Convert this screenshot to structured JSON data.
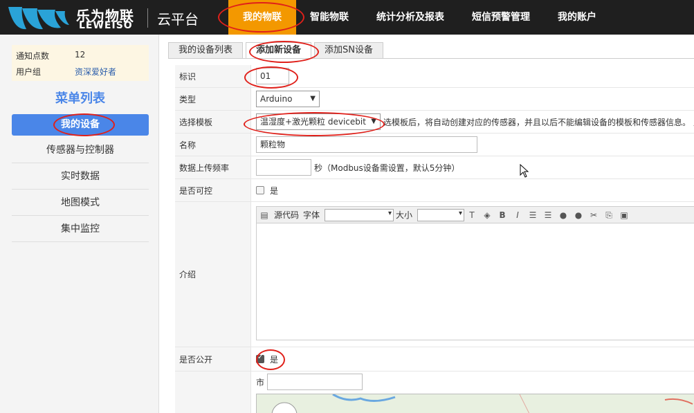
{
  "header": {
    "brand_cn": "乐为物联",
    "brand_en": "LEWEISO",
    "platform": "云平台",
    "nav": [
      "我的物联",
      "智能物联",
      "统计分析及报表",
      "短信预警管理",
      "我的账户"
    ],
    "accent": "#f39800"
  },
  "sidebar": {
    "info": [
      {
        "label": "通知点数",
        "value": "12"
      },
      {
        "label": "用户组",
        "value": "资深爱好者"
      }
    ],
    "menu_title": "菜单列表",
    "active_item": "我的设备",
    "items": [
      "传感器与控制器",
      "实时数据",
      "地图模式",
      "集中监控"
    ]
  },
  "tabs": [
    "我的设备列表",
    "添加新设备",
    "添加SN设备"
  ],
  "form": {
    "id_label": "标识",
    "id_value": "01",
    "type_label": "类型",
    "type_value": "Arduino",
    "template_label": "选择模板",
    "template_value": "温湿度+激光颗粒 devicebit",
    "template_hint": "选模板后，将自动创建对应的传感器，并且以后不能编辑设备的模板和传感器信息。 点",
    "name_label": "名称",
    "name_value": "颗粒物",
    "freq_label": "数据上传频率",
    "freq_value": "",
    "freq_hint": "秒（Modbus设备需设置，默认5分钟）",
    "controllable_label": "是否可控",
    "controllable_option": "是",
    "intro_label": "介绍",
    "editor": {
      "source": "源代码",
      "font": "字体",
      "size": "大小"
    },
    "public_label": "是否公开",
    "public_option": "是",
    "city_label": "市",
    "city_value": ""
  }
}
